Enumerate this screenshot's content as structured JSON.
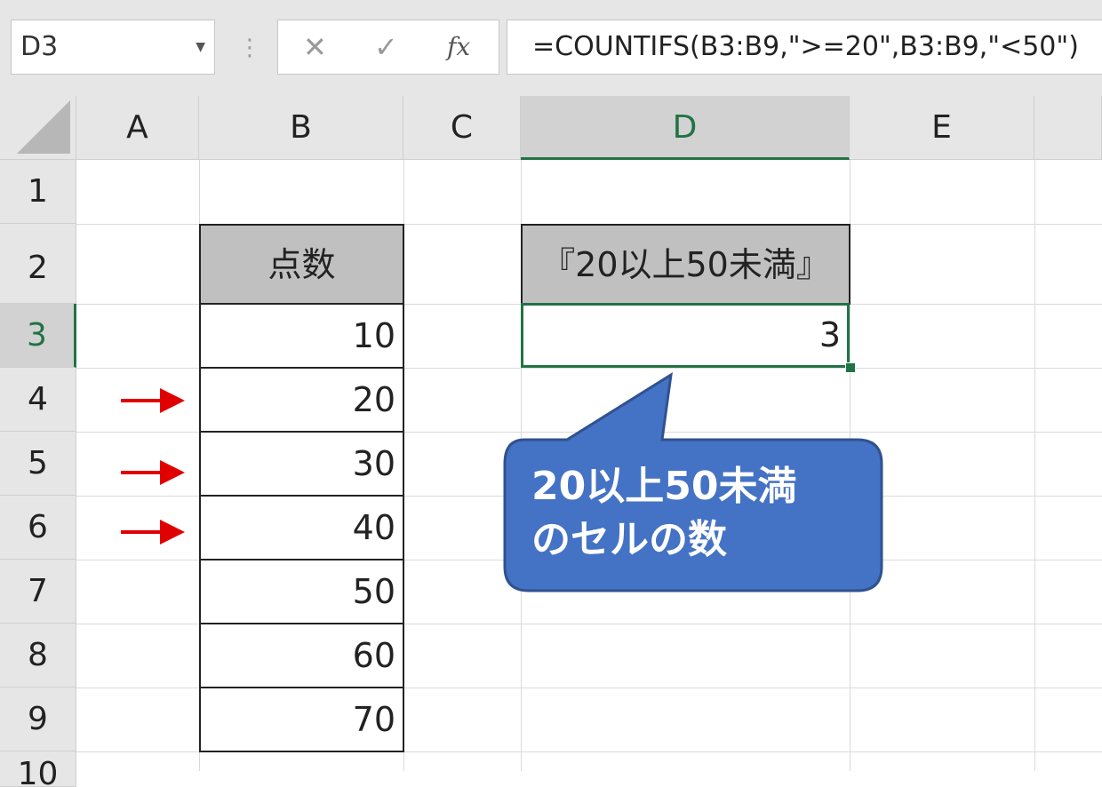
{
  "formula_bar": {
    "name_box": "D3",
    "formula": "=COUNTIFS(B3:B9,\">=20\",B3:B9,\"<50\")",
    "cancel_icon": "cancel-x-icon",
    "enter_icon": "checkmark-icon",
    "function_icon": "fx-icon",
    "fx_label": "fx"
  },
  "columns": [
    "A",
    "B",
    "C",
    "D",
    "E"
  ],
  "rows": [
    "1",
    "2",
    "3",
    "4",
    "5",
    "6",
    "7",
    "8",
    "9",
    "10"
  ],
  "table": {
    "header": "点数",
    "values": [
      "10",
      "20",
      "30",
      "40",
      "50",
      "60",
      "70"
    ]
  },
  "result": {
    "header": "『20以上50未満』",
    "value": "3"
  },
  "callout": {
    "line1": "20以上50未満",
    "line2": "のセルの数"
  },
  "colors": {
    "accent_green": "#217346",
    "callout_fill": "#4472C4",
    "arrow_red": "#e00000"
  }
}
